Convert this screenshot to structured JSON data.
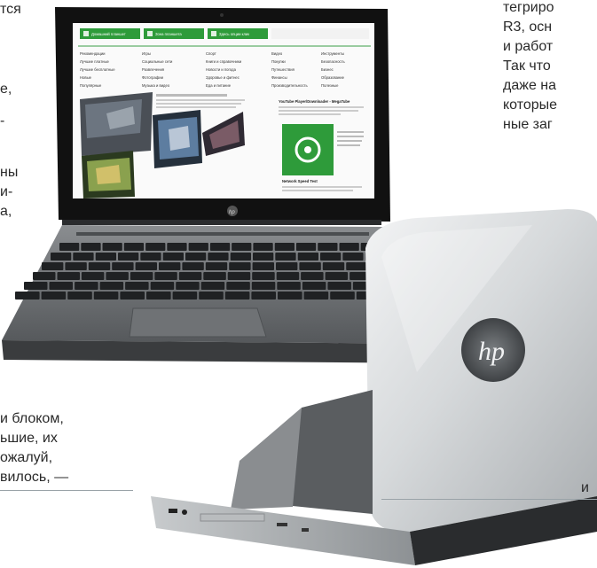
{
  "left_column": {
    "lines": [
      "тся",
      "е,",
      "-",
      "ны",
      "и-",
      "а,"
    ],
    "bottom_lines": [
      "и блоком,",
      "ьшие, их",
      "ожалуй,",
      "вилось, —"
    ]
  },
  "right_column": {
    "lines": [
      "тегриро",
      "R3, осн",
      "и работ",
      "Так что",
      "даже на",
      "которые",
      "ные заг"
    ],
    "bottom_char": "и"
  },
  "screen": {
    "tabs": [
      "Домашний планшет",
      "Зона планшета",
      "Здесь опции клик"
    ],
    "categories": [
      [
        "Рекомендации",
        "Игры",
        "Спорт",
        "Видео",
        "Инструменты"
      ],
      [
        "Лучшие платные",
        "Социальные сети",
        "Книги и справочники",
        "Покупки",
        "Безопасность"
      ],
      [
        "Лучшие бесплатные",
        "Развлечения",
        "Новости и погода",
        "Путешествия",
        "Бизнес"
      ],
      [
        "Новые",
        "Фотографии",
        "Здоровье и фитнес",
        "Финансы",
        "Образование"
      ],
      [
        "Популярные",
        "Музыка и видео",
        "Еда и питание",
        "Производительность",
        "Полезные"
      ]
    ],
    "featured_title": "YouTube Player/Downloader - MegaTube",
    "app_title": "Network Speed Test",
    "brand": "hp"
  }
}
